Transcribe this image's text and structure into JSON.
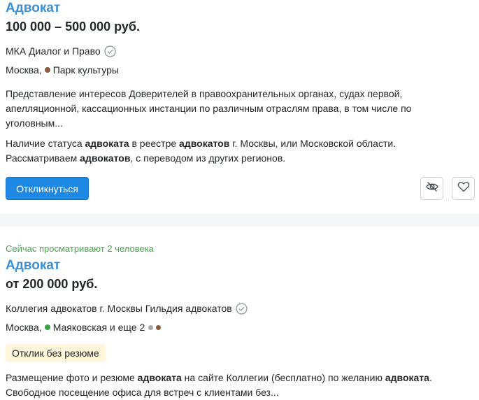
{
  "vacancies": [
    {
      "title": "Адвокат",
      "salary": "100 000 – 500 000 руб.",
      "company": "МКА Диалог и Право",
      "city": "Москва,",
      "metro": "Парк культуры",
      "metro_color": "#8a5a3c",
      "description": "Представление интересов Доверителей в правоохранительных органах, судах первой, апелляционной, кассационных инстанции по различным отраслям права, в том числе по уголовным...",
      "requirements_parts": {
        "p1": "Наличие статуса ",
        "b1": "адвоката",
        "p2": " в реестре ",
        "b2": "адвокатов",
        "p3": " г. Москвы, или Московской области. Рассматриваем ",
        "b3": "адвокатов",
        "p4": ", с переводом из других регионов."
      },
      "respond_label": "Откликнуться",
      "hide_icon": "eye-crossed-icon",
      "favorite_icon": "heart-icon"
    },
    {
      "viewing_now": "Сейчас просматривают 2 человека",
      "title": "Адвокат",
      "salary": "от 200 000 руб.",
      "company": "Коллегия адвокатов г. Москвы Гильдия адвокатов",
      "city": "Москва,",
      "metro": "Маяковская и еще 2",
      "metro_color": "#3aa346",
      "extra_metro_colors": [
        "#a8a8a8",
        "#8a5a3c"
      ],
      "badge": "Отклик без резюме",
      "description_parts": {
        "p1": "Размещение фото и резюме ",
        "b1": "адвоката",
        "p2": " на сайте Коллегии (бесплатно) по желанию ",
        "b2": "адвоката",
        "p3": ". Свободное посещение офиса для встреч с клиентами без..."
      }
    }
  ],
  "colors": {
    "title_link": "#3a8fd6",
    "primary_button": "#1e88e5",
    "viewing_now": "#4aa34f",
    "badge_bg": "#fff6db"
  }
}
